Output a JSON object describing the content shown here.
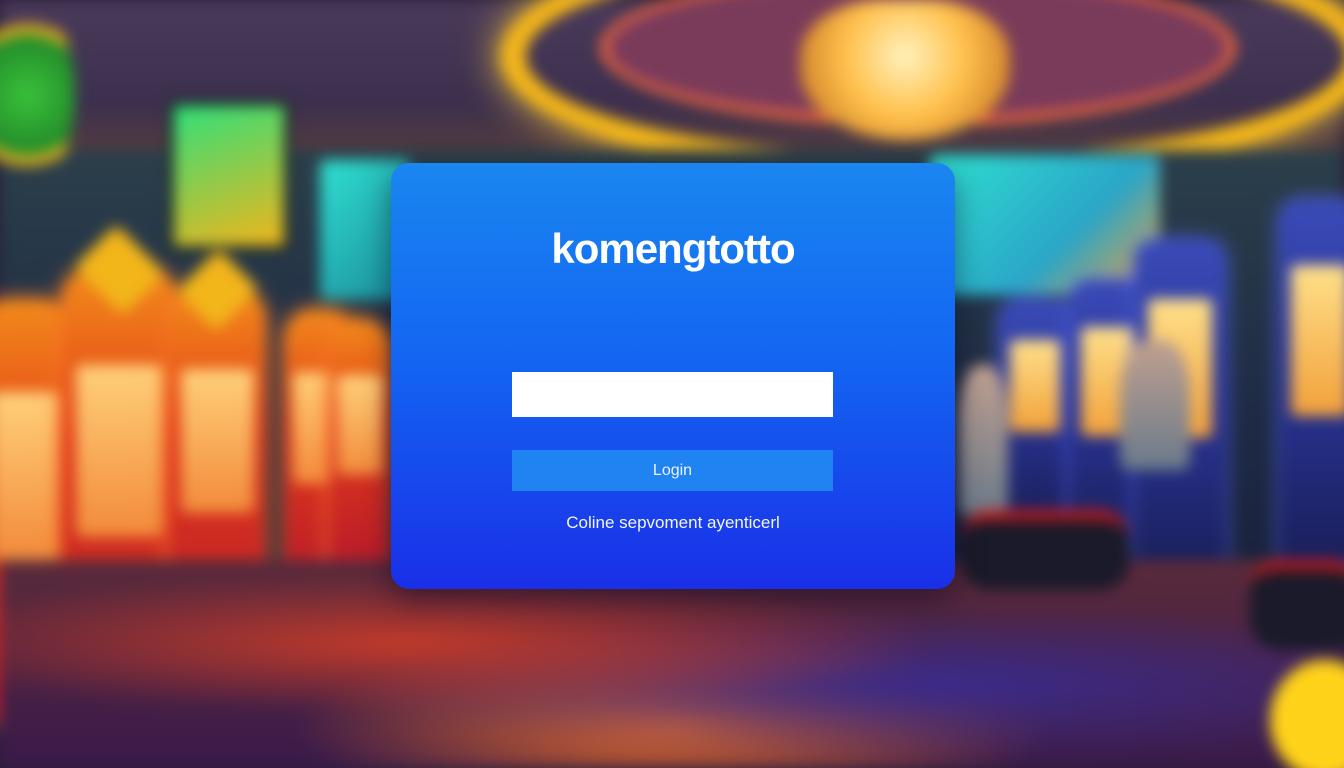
{
  "brand": {
    "name": "komengtotto"
  },
  "login_form": {
    "username_value": "",
    "username_placeholder": "",
    "login_label": "Login",
    "footer_text": "Coline sepvoment ayenticerl"
  },
  "colors": {
    "card_top": "#1a86f0",
    "card_bottom": "#1a2fe8",
    "button": "#1f84f2",
    "input": "#ffffff"
  }
}
